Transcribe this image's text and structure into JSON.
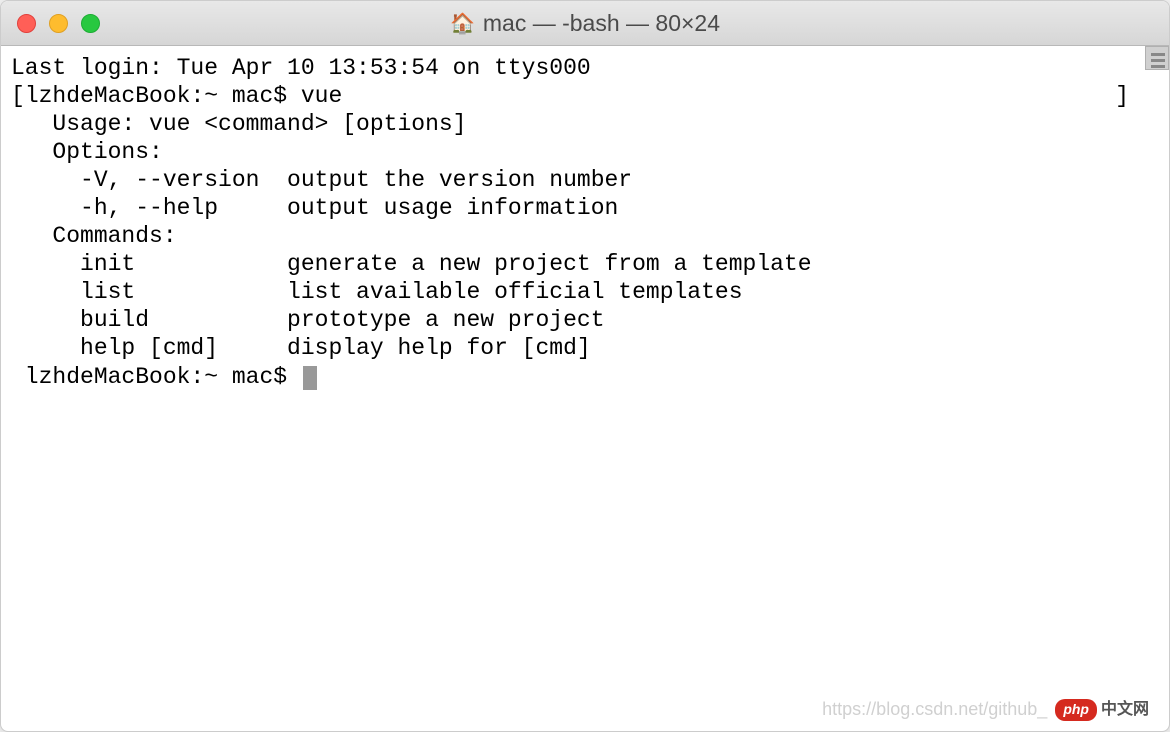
{
  "window": {
    "title": "mac — -bash — 80×24"
  },
  "terminal": {
    "last_login": "Last login: Tue Apr 10 13:53:54 on ttys000",
    "prompt1_bracket_left": "[",
    "prompt1": "lzhdeMacBook:~ mac$ vue",
    "prompt1_bracket_right": "]",
    "blank1": "",
    "usage_line": "   Usage: vue <command> [options]",
    "blank2": "",
    "options_header": "   Options:",
    "blank3": "",
    "option_version": "     -V, --version  output the version number",
    "option_help": "     -h, --help     output usage information",
    "blank4": "",
    "commands_header": "   Commands:",
    "blank5": "",
    "command_init": "     init           generate a new project from a template",
    "command_list": "     list           list available official templates",
    "command_build": "     build          prototype a new project",
    "command_help": "     help [cmd]     display help for [cmd]",
    "prompt2": " lzhdeMacBook:~ mac$ "
  },
  "watermark": {
    "url": "https://blog.csdn.net/github_",
    "badge": "php",
    "cn": "中文网"
  }
}
